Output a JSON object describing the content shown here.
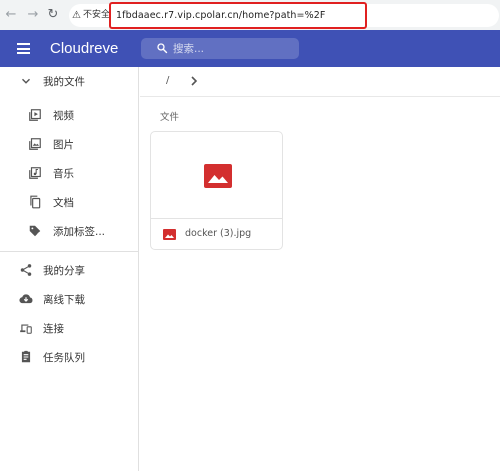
{
  "browser": {
    "security_label": "不安全",
    "url": "1fbdaaec.r7.vip.cpolar.cn/home?path=%2F"
  },
  "header": {
    "title": "Cloudreve",
    "search_placeholder": "搜索..."
  },
  "sidebar": {
    "my_files": "我的文件",
    "categories": [
      {
        "label": "视频",
        "icon": "video-icon"
      },
      {
        "label": "图片",
        "icon": "image-icon"
      },
      {
        "label": "音乐",
        "icon": "music-icon"
      },
      {
        "label": "文档",
        "icon": "document-icon"
      },
      {
        "label": "添加标签...",
        "icon": "add-tag-icon"
      }
    ],
    "items": [
      {
        "label": "我的分享",
        "icon": "share-icon"
      },
      {
        "label": "离线下载",
        "icon": "cloud-download-icon"
      },
      {
        "label": "连接",
        "icon": "devices-icon"
      },
      {
        "label": "任务队列",
        "icon": "task-queue-icon"
      }
    ]
  },
  "main": {
    "breadcrumb_root": "/",
    "section_title": "文件",
    "files": [
      {
        "name": "docker (3).jpg",
        "icon": "image-file-icon"
      }
    ]
  },
  "colors": {
    "primary": "#3f51b5",
    "image_icon": "#d32f2f",
    "url_highlight": "#e02020"
  }
}
